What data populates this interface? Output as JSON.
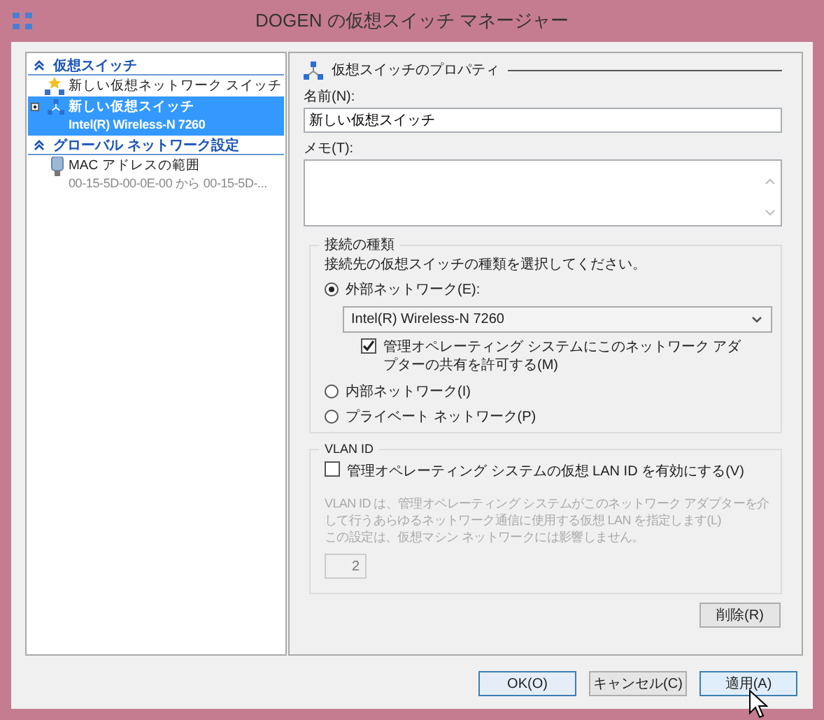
{
  "window": {
    "title": "DOGEN の仮想スイッチ マネージャー"
  },
  "sidebar": {
    "sections": [
      {
        "title": "仮想スイッチ",
        "expanded": true,
        "items": [
          {
            "kind": "new",
            "label": "新しい仮想ネットワーク スイッチ",
            "selected": false
          },
          {
            "kind": "switch",
            "label": "新しい仮想スイッチ",
            "detail": "Intel(R) Wireless-N 7260",
            "selected": true
          }
        ]
      },
      {
        "title": "グローバル ネットワーク設定",
        "expanded": true,
        "items": [
          {
            "kind": "mac",
            "label": "MAC アドレスの範囲",
            "detail": "00-15-5D-00-0E-00 から 00-15-5D-...",
            "selected": false
          }
        ]
      }
    ]
  },
  "properties": {
    "heading": "仮想スイッチのプロパティ",
    "name_label": "名前(N):",
    "name_value": "新しい仮想スイッチ",
    "memo_label": "メモ(T):",
    "connection_type": {
      "title": "接続の種類",
      "description": "接続先の仮想スイッチの種類を選択してください。",
      "options": [
        {
          "label": "外部ネットワーク(E):",
          "selected": true
        },
        {
          "label": "内部ネットワーク(I)",
          "selected": false
        },
        {
          "label": "プライベート ネットワーク(P)",
          "selected": false
        }
      ],
      "adapter": "Intel(R) Wireless-N 7260",
      "share": {
        "label": "管理オペレーティング システムにこのネットワーク アダプターの共有を許可する(M)",
        "checked": true
      }
    },
    "vlan": {
      "title": "VLAN ID",
      "checkbox": {
        "label": "管理オペレーティング システムの仮想 LAN ID を有効にする(V)",
        "checked": false
      },
      "description": [
        "VLAN ID は、管理オペレーティング システムがこのネットワーク アダプターを介して行うあらゆるネットワーク通信に使用する仮想 LAN を指定します(L)",
        "この設定は、仮想マシン ネットワークには影響しません。"
      ],
      "value": "2",
      "disabled": true
    },
    "remove_button": "削除(R)"
  },
  "buttons": [
    {
      "label": "OK(O)",
      "kind": "default"
    },
    {
      "label": "キャンセル(C)",
      "kind": "normal"
    },
    {
      "label": "適用(A)",
      "kind": "hover"
    }
  ]
}
